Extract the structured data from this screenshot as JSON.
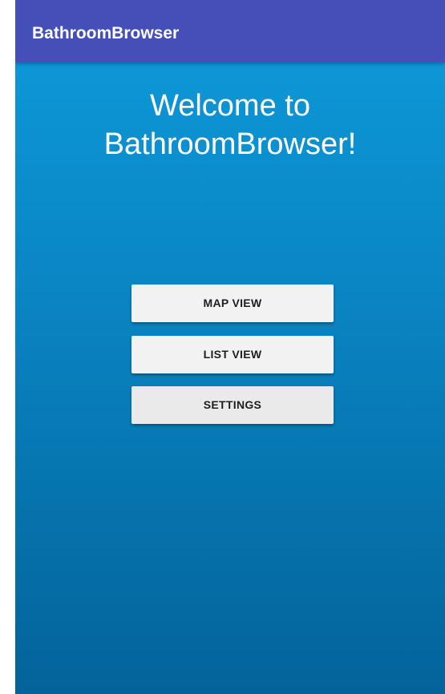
{
  "app_bar": {
    "title": "BathroomBrowser"
  },
  "main": {
    "welcome_line1": "Welcome to",
    "welcome_line2": "BathroomBrowser!",
    "buttons": {
      "map_view": "MAP VIEW",
      "list_view": "LIST VIEW",
      "settings": "SETTINGS"
    }
  },
  "colors": {
    "app_bar": "#4450b8",
    "background_top": "#0d96d6",
    "background_bottom": "#04639a",
    "button": "#f2f2f2"
  }
}
